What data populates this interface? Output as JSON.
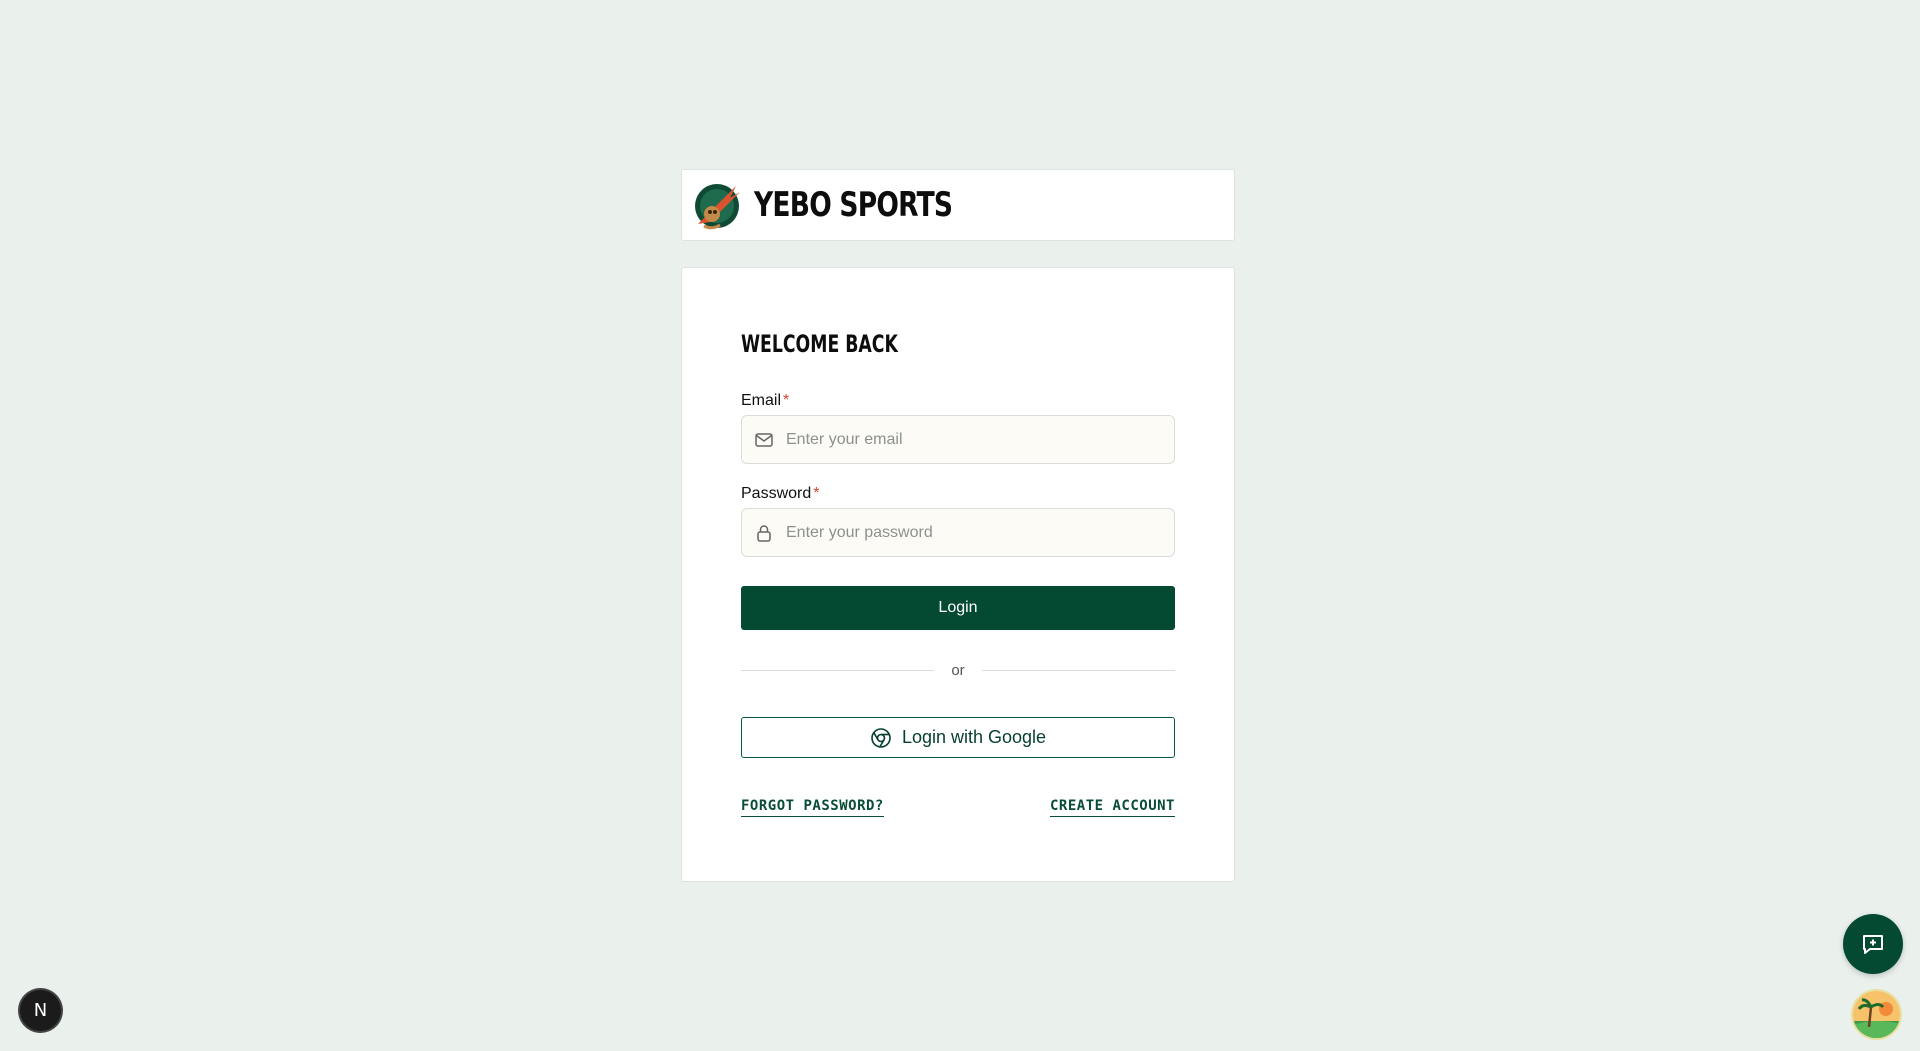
{
  "brand": {
    "name": "YEBO SPORTS",
    "logo_icon": "yebo-sports-logo"
  },
  "login": {
    "heading": "WELCOME BACK",
    "email": {
      "label": "Email",
      "required_mark": "*",
      "placeholder": "Enter your email",
      "value": "",
      "icon": "mail-icon"
    },
    "password": {
      "label": "Password",
      "required_mark": "*",
      "placeholder": "Enter your password",
      "value": "",
      "icon": "lock-icon"
    },
    "submit_label": "Login",
    "divider_text": "or",
    "google_label": "Login with Google",
    "google_icon": "chrome-icon",
    "forgot_password_label": "FORGOT PASSWORD?",
    "create_account_label": "CREATE ACCOUNT"
  },
  "widgets": {
    "chat_icon": "message-plus-icon",
    "avatar_icon": "tropical-avatar",
    "dev_badge_label": "N"
  },
  "colors": {
    "primary": "#044a33",
    "background": "#eaf0ec",
    "required": "#d9462b"
  }
}
